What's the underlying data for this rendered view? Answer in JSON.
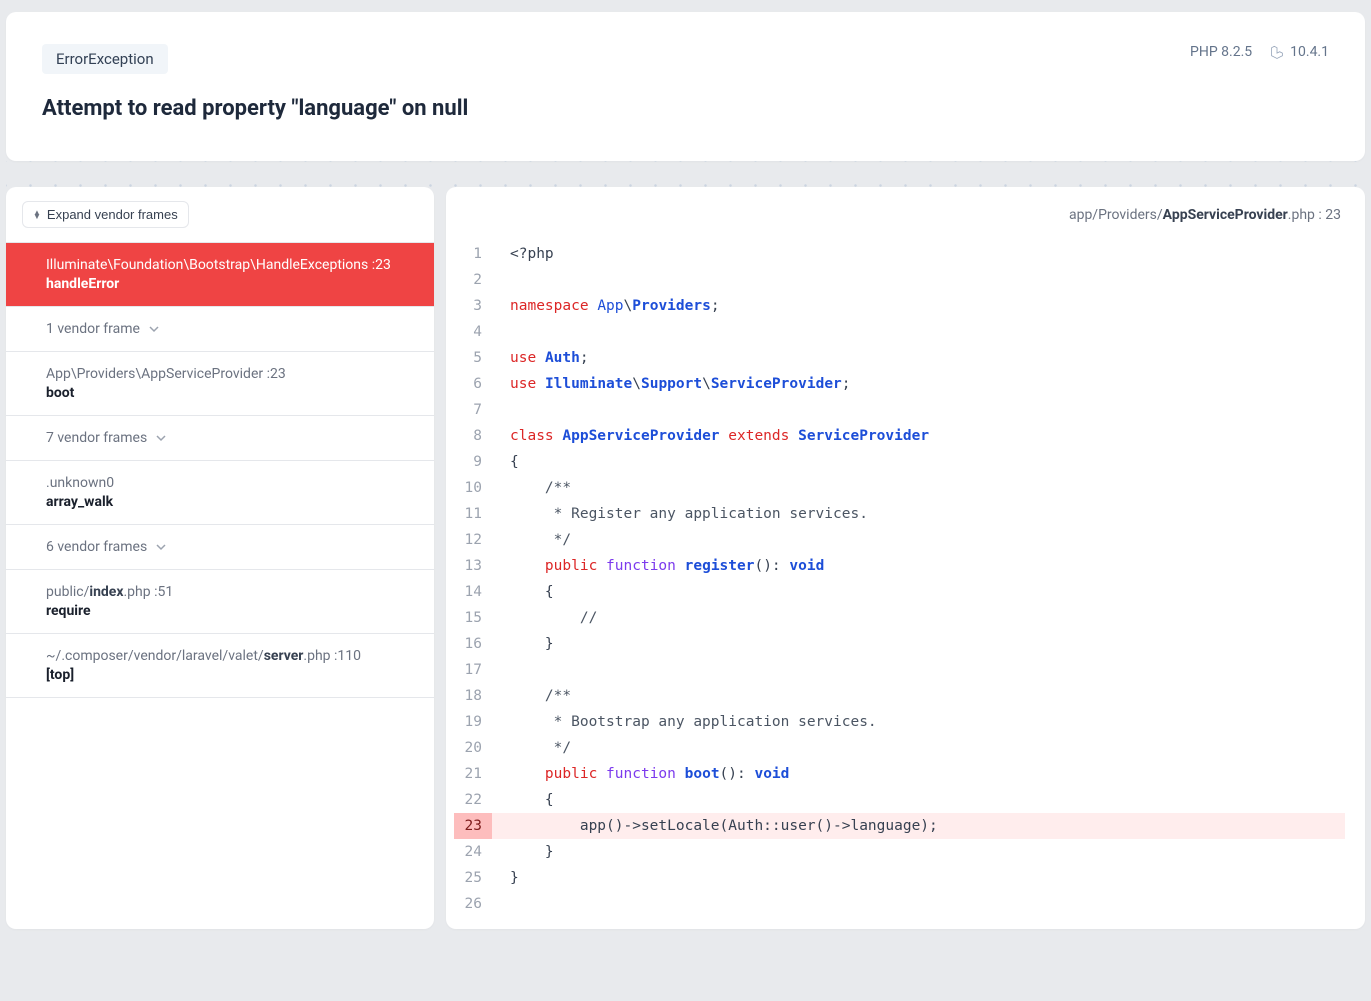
{
  "header": {
    "exception_class": "ErrorException",
    "php_version": "PHP 8.2.5",
    "framework_version": "10.4.1",
    "title": "Attempt to read property \"language\" on null"
  },
  "sidebar": {
    "expand_label": "Expand vendor frames",
    "frames": [
      {
        "type": "frame",
        "active": true,
        "path": "Illuminate\\Foundation\\Bootstrap\\HandleExceptions",
        "line": "23",
        "method": "handleError"
      },
      {
        "type": "collapsed",
        "label": "1 vendor frame"
      },
      {
        "type": "frame",
        "active": false,
        "path": "App\\Providers\\AppServiceProvider",
        "line": "23",
        "method": "boot"
      },
      {
        "type": "collapsed",
        "label": "7 vendor frames"
      },
      {
        "type": "frame",
        "active": false,
        "path": ".unknown0",
        "line": "",
        "method": "array_walk"
      },
      {
        "type": "collapsed",
        "label": "6 vendor frames"
      },
      {
        "type": "frame",
        "active": false,
        "path_html": true,
        "segs": [
          "public",
          "/",
          "index",
          ".php"
        ],
        "bold_idx": 2,
        "line": "51",
        "method": "require"
      },
      {
        "type": "frame",
        "active": false,
        "path_html": true,
        "segs": [
          "~",
          "/",
          ".composer",
          "/",
          "vendor",
          "/",
          "laravel",
          "/",
          "valet",
          "/",
          "server",
          ".php"
        ],
        "bold_idx": 10,
        "line": "110",
        "method": "[top]"
      }
    ]
  },
  "code": {
    "breadcrumb": {
      "prefix": "app/Providers/",
      "file": "AppServiceProvider",
      "suffix": ".php",
      "line": "23"
    },
    "highlighted_line": 23,
    "lines": [
      {
        "n": 1,
        "tokens": [
          {
            "c": "t-punct",
            "t": "<?"
          },
          {
            "c": "t-plain",
            "t": "php"
          }
        ]
      },
      {
        "n": 2,
        "tokens": []
      },
      {
        "n": 3,
        "tokens": [
          {
            "c": "t-keyword",
            "t": "namespace"
          },
          {
            "c": "",
            "t": " "
          },
          {
            "c": "t-ns",
            "t": "App"
          },
          {
            "c": "t-punct",
            "t": "\\"
          },
          {
            "c": "t-type",
            "t": "Providers"
          },
          {
            "c": "t-punct",
            "t": ";"
          }
        ]
      },
      {
        "n": 4,
        "tokens": []
      },
      {
        "n": 5,
        "tokens": [
          {
            "c": "t-keyword",
            "t": "use"
          },
          {
            "c": "",
            "t": " "
          },
          {
            "c": "t-type",
            "t": "Auth"
          },
          {
            "c": "t-punct",
            "t": ";"
          }
        ]
      },
      {
        "n": 6,
        "tokens": [
          {
            "c": "t-keyword",
            "t": "use"
          },
          {
            "c": "",
            "t": " "
          },
          {
            "c": "t-type",
            "t": "Illuminate"
          },
          {
            "c": "t-punct",
            "t": "\\"
          },
          {
            "c": "t-type",
            "t": "Support"
          },
          {
            "c": "t-punct",
            "t": "\\"
          },
          {
            "c": "t-type",
            "t": "ServiceProvider"
          },
          {
            "c": "t-punct",
            "t": ";"
          }
        ]
      },
      {
        "n": 7,
        "tokens": []
      },
      {
        "n": 8,
        "tokens": [
          {
            "c": "t-keyword",
            "t": "class"
          },
          {
            "c": "",
            "t": " "
          },
          {
            "c": "t-type",
            "t": "AppServiceProvider"
          },
          {
            "c": "",
            "t": " "
          },
          {
            "c": "t-keyword",
            "t": "extends"
          },
          {
            "c": "",
            "t": " "
          },
          {
            "c": "t-type",
            "t": "ServiceProvider"
          }
        ]
      },
      {
        "n": 9,
        "tokens": [
          {
            "c": "t-punct",
            "t": "{"
          }
        ]
      },
      {
        "n": 10,
        "tokens": [
          {
            "c": "",
            "t": "    "
          },
          {
            "c": "t-comment",
            "t": "/**"
          }
        ]
      },
      {
        "n": 11,
        "tokens": [
          {
            "c": "",
            "t": "     "
          },
          {
            "c": "t-comment",
            "t": "* Register any application services."
          }
        ]
      },
      {
        "n": 12,
        "tokens": [
          {
            "c": "",
            "t": "     "
          },
          {
            "c": "t-comment",
            "t": "*/"
          }
        ]
      },
      {
        "n": 13,
        "tokens": [
          {
            "c": "",
            "t": "    "
          },
          {
            "c": "t-keyword",
            "t": "public"
          },
          {
            "c": "",
            "t": " "
          },
          {
            "c": "t-func",
            "t": "function"
          },
          {
            "c": "",
            "t": " "
          },
          {
            "c": "t-type",
            "t": "register"
          },
          {
            "c": "t-punct",
            "t": "(): "
          },
          {
            "c": "t-type",
            "t": "void"
          }
        ]
      },
      {
        "n": 14,
        "tokens": [
          {
            "c": "",
            "t": "    "
          },
          {
            "c": "t-punct",
            "t": "{"
          }
        ]
      },
      {
        "n": 15,
        "tokens": [
          {
            "c": "",
            "t": "        "
          },
          {
            "c": "t-comment",
            "t": "//"
          }
        ]
      },
      {
        "n": 16,
        "tokens": [
          {
            "c": "",
            "t": "    "
          },
          {
            "c": "t-punct",
            "t": "}"
          }
        ]
      },
      {
        "n": 17,
        "tokens": []
      },
      {
        "n": 18,
        "tokens": [
          {
            "c": "",
            "t": "    "
          },
          {
            "c": "t-comment",
            "t": "/**"
          }
        ]
      },
      {
        "n": 19,
        "tokens": [
          {
            "c": "",
            "t": "     "
          },
          {
            "c": "t-comment",
            "t": "* Bootstrap any application services."
          }
        ]
      },
      {
        "n": 20,
        "tokens": [
          {
            "c": "",
            "t": "     "
          },
          {
            "c": "t-comment",
            "t": "*/"
          }
        ]
      },
      {
        "n": 21,
        "tokens": [
          {
            "c": "",
            "t": "    "
          },
          {
            "c": "t-keyword",
            "t": "public"
          },
          {
            "c": "",
            "t": " "
          },
          {
            "c": "t-func",
            "t": "function"
          },
          {
            "c": "",
            "t": " "
          },
          {
            "c": "t-type",
            "t": "boot"
          },
          {
            "c": "t-punct",
            "t": "(): "
          },
          {
            "c": "t-type",
            "t": "void"
          }
        ]
      },
      {
        "n": 22,
        "tokens": [
          {
            "c": "",
            "t": "    "
          },
          {
            "c": "t-punct",
            "t": "{"
          }
        ]
      },
      {
        "n": 23,
        "tokens": [
          {
            "c": "",
            "t": "        "
          },
          {
            "c": "t-plain",
            "t": "app()->setLocale(Auth::user()->language);"
          }
        ]
      },
      {
        "n": 24,
        "tokens": [
          {
            "c": "",
            "t": "    "
          },
          {
            "c": "t-punct",
            "t": "}"
          }
        ]
      },
      {
        "n": 25,
        "tokens": [
          {
            "c": "t-punct",
            "t": "}"
          }
        ]
      },
      {
        "n": 26,
        "tokens": []
      }
    ]
  }
}
